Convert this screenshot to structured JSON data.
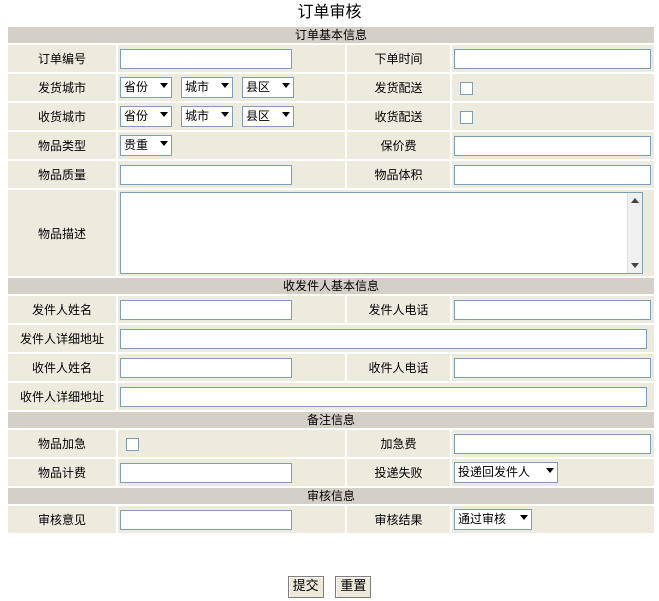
{
  "page": {
    "title": "订单审核"
  },
  "sections": {
    "basic": "订单基本信息",
    "people": "收发件人基本信息",
    "notes": "备注信息",
    "audit": "审核信息"
  },
  "labels": {
    "order_no": "订单编号",
    "order_time": "下单时间",
    "ship_city": "发货城市",
    "ship_delivery": "发货配送",
    "recv_city": "收货城市",
    "recv_delivery": "收货配送",
    "goods_type": "物品类型",
    "insured": "保价费",
    "goods_weight": "物品质量",
    "goods_volume": "物品体积",
    "goods_desc": "物品描述",
    "sender_name": "发件人姓名",
    "sender_phone": "发件人电话",
    "sender_addr": "发件人详细地址",
    "recv_name": "收件人姓名",
    "recv_phone": "收件人电话",
    "recv_addr": "收件人详细地址",
    "urgent": "物品加急",
    "urgent_fee": "加急费",
    "goods_fee": "物品计费",
    "delivery_fail": "投递失败",
    "audit_opinion": "审核意见",
    "audit_result": "审核结果"
  },
  "selects": {
    "province": "省份",
    "city": "城市",
    "district": "县区",
    "goods_type": "贵重",
    "delivery_fail": "投递回发件人",
    "audit_result": "通过审核"
  },
  "buttons": {
    "submit": "提交",
    "reset": "重置"
  }
}
